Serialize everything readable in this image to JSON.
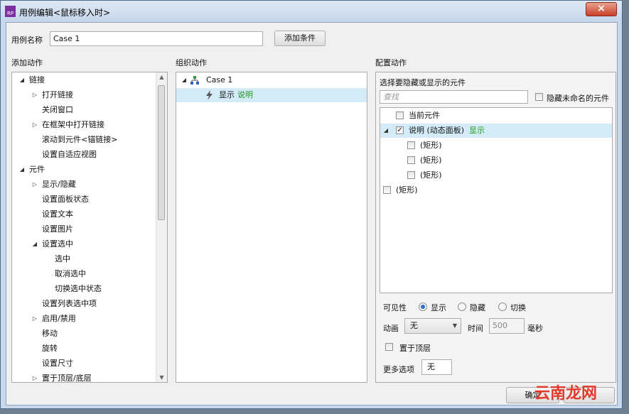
{
  "window": {
    "title": "用例编辑<鼠标移入时>",
    "app_icon": "RP",
    "close": "×"
  },
  "case_name": {
    "label": "用例名称",
    "value": "Case 1",
    "add_condition": "添加条件"
  },
  "sections": {
    "add_actions": "添加动作",
    "organize_actions": "组织动作",
    "configure_actions": "配置动作"
  },
  "action_tree": [
    {
      "label": "链接",
      "expander": "◢",
      "level": 0
    },
    {
      "label": "打开链接",
      "expander": "▷",
      "level": 1
    },
    {
      "label": "关闭窗口",
      "expander": "",
      "level": 1
    },
    {
      "label": "在框架中打开链接",
      "expander": "▷",
      "level": 1
    },
    {
      "label": "滚动到元件<锚链接>",
      "expander": "",
      "level": 1
    },
    {
      "label": "设置自适应视图",
      "expander": "",
      "level": 1
    },
    {
      "label": "元件",
      "expander": "◢",
      "level": 0
    },
    {
      "label": "显示/隐藏",
      "expander": "▷",
      "level": 1
    },
    {
      "label": "设置面板状态",
      "expander": "",
      "level": 1
    },
    {
      "label": "设置文本",
      "expander": "",
      "level": 1
    },
    {
      "label": "设置图片",
      "expander": "",
      "level": 1
    },
    {
      "label": "设置选中",
      "expander": "◢",
      "level": 1
    },
    {
      "label": "选中",
      "expander": "",
      "level": 2
    },
    {
      "label": "取消选中",
      "expander": "",
      "level": 2
    },
    {
      "label": "切换选中状态",
      "expander": "",
      "level": 2
    },
    {
      "label": "设置列表选中项",
      "expander": "",
      "level": 1
    },
    {
      "label": "启用/禁用",
      "expander": "▷",
      "level": 1
    },
    {
      "label": "移动",
      "expander": "",
      "level": 1
    },
    {
      "label": "旋转",
      "expander": "",
      "level": 1
    },
    {
      "label": "设置尺寸",
      "expander": "",
      "level": 1
    },
    {
      "label": "置于顶层/底层",
      "expander": "▷",
      "level": 1
    }
  ],
  "organize": {
    "case": "Case 1",
    "case_expander": "◢",
    "action_verb": "显示",
    "action_target": "说明"
  },
  "configure": {
    "prompt": "选择要隐藏或显示的元件",
    "search_placeholder": "查找",
    "hide_unnamed": "隐藏未命名的元件",
    "widgets": [
      {
        "label": "当前元件",
        "state": "",
        "checked": false,
        "level": 0,
        "expander": "",
        "selected": false
      },
      {
        "label": "说明 (动态面板)",
        "state": "显示",
        "checked": true,
        "level": 0,
        "expander": "◢",
        "selected": true
      },
      {
        "label": "(矩形)",
        "state": "",
        "checked": false,
        "level": 1,
        "expander": "",
        "selected": false
      },
      {
        "label": "(矩形)",
        "state": "",
        "checked": false,
        "level": 1,
        "expander": "",
        "selected": false
      },
      {
        "label": "(矩形)",
        "state": "",
        "checked": false,
        "level": 1,
        "expander": "",
        "selected": false
      },
      {
        "label": "(矩形)",
        "state": "",
        "checked": false,
        "level": -1,
        "expander": "",
        "selected": false
      }
    ],
    "visibility": {
      "label": "可见性",
      "options": [
        "显示",
        "隐藏",
        "切换"
      ],
      "selected": "显示"
    },
    "animation": {
      "label": "动画",
      "value": "无",
      "time_label": "时间",
      "time_value": "500",
      "unit": "毫秒"
    },
    "bring_to_front": {
      "label": "置于顶层",
      "checked": false
    },
    "more_options": {
      "label": "更多选项",
      "value": "无"
    }
  },
  "footer": {
    "ok": "确定"
  },
  "watermark": "云南龙网",
  "accent_color": "#d3ecf7",
  "state_color": "#1a9a1a"
}
